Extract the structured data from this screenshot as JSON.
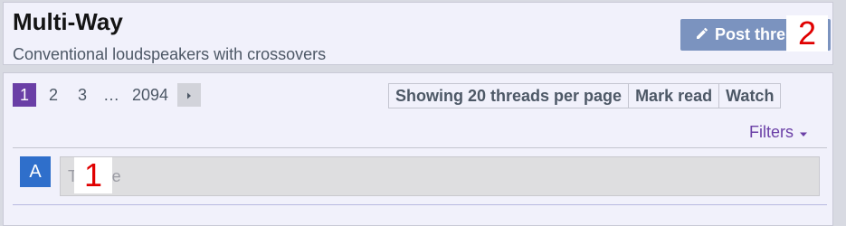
{
  "header": {
    "title": "Multi-Way",
    "subtitle": "Conventional loudspeakers with crossovers",
    "post_button_label": "Post thre"
  },
  "markers": {
    "one": "1",
    "two": "2"
  },
  "pagination": {
    "pages": [
      "1",
      "2",
      "3"
    ],
    "ellipsis": "…",
    "last_page": "2094",
    "current": "1"
  },
  "toolbar": {
    "threads_per_page": "Showing 20 threads per page",
    "mark_read": "Mark read",
    "watch": "Watch"
  },
  "filters": {
    "label": "Filters"
  },
  "new_thread": {
    "avatar_letter": "A",
    "title_placeholder": "Thread title",
    "title_visible": "T     d title"
  },
  "colors": {
    "accent": "#6a3fa6",
    "post_button": "#7b93bf",
    "avatar": "#2f6fcb",
    "marker_text": "#e00000"
  },
  "icons": {
    "post": "pencil-icon",
    "next": "chevron-right-icon",
    "filters": "caret-down-icon"
  }
}
